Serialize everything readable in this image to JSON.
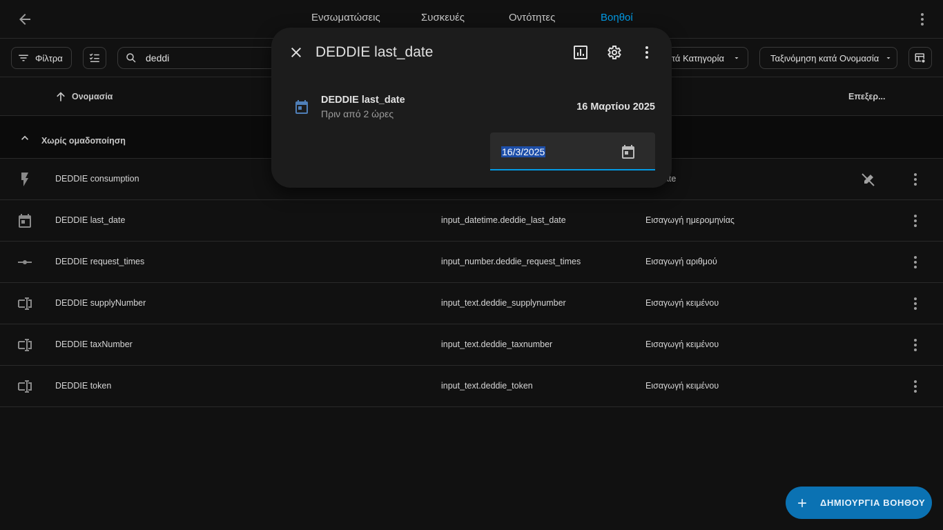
{
  "colors": {
    "background": "#111111",
    "accent": "#039be5",
    "dialog": "#1c1c1c",
    "fab": "#0b72b3"
  },
  "topbar": {
    "tabs": [
      {
        "label": "Ενσωματώσεις",
        "active": false
      },
      {
        "label": "Συσκευές",
        "active": false
      },
      {
        "label": "Οντότητες",
        "active": false
      },
      {
        "label": "Βοηθοί",
        "active": true
      }
    ]
  },
  "toolbar": {
    "filter_label": "Φίλτρα",
    "search_value": "deddi",
    "group_label": "ατά Κατηγορία",
    "sort_label": "Ταξινόμηση κατά Ονομασία"
  },
  "table": {
    "headers": {
      "name": "Ονομασία",
      "edit": "Επεξερ..."
    },
    "group_label": "Χωρίς ομαδοποίηση",
    "rows": [
      {
        "icon": "flash-icon",
        "name": "DEDDIE consumption",
        "entity": "",
        "type": "...nate",
        "editable": false
      },
      {
        "icon": "calendar-icon",
        "name": "DEDDIE last_date",
        "entity": "input_datetime.deddie_last_date",
        "type": "Εισαγωγή ημερομηνίας",
        "editable": true
      },
      {
        "icon": "slider-icon",
        "name": "DEDDIE request_times",
        "entity": "input_number.deddie_request_times",
        "type": "Εισαγωγή αριθμού",
        "editable": true
      },
      {
        "icon": "text-field-icon",
        "name": "DEDDIE supplyNumber",
        "entity": "input_text.deddie_supplynumber",
        "type": "Εισαγωγή κειμένου",
        "editable": true
      },
      {
        "icon": "text-field-icon",
        "name": "DEDDIE taxNumber",
        "entity": "input_text.deddie_taxnumber",
        "type": "Εισαγωγή κειμένου",
        "editable": true
      },
      {
        "icon": "text-field-icon",
        "name": "DEDDIE token",
        "entity": "input_text.deddie_token",
        "type": "Εισαγωγή κειμένου",
        "editable": true
      }
    ],
    "row0_type_visible": "nate"
  },
  "dialog": {
    "title": "DEDDIE last_date",
    "entity_name": "DEDDIE last_date",
    "last_changed": "Πριν από 2 ώρες",
    "state": "16 Μαρτίου 2025",
    "date_input_value": "16/3/2025"
  },
  "fab": {
    "label": "ΔΗΜΙΟΥΡΓΙΑ ΒΟΗΘΟΥ"
  }
}
